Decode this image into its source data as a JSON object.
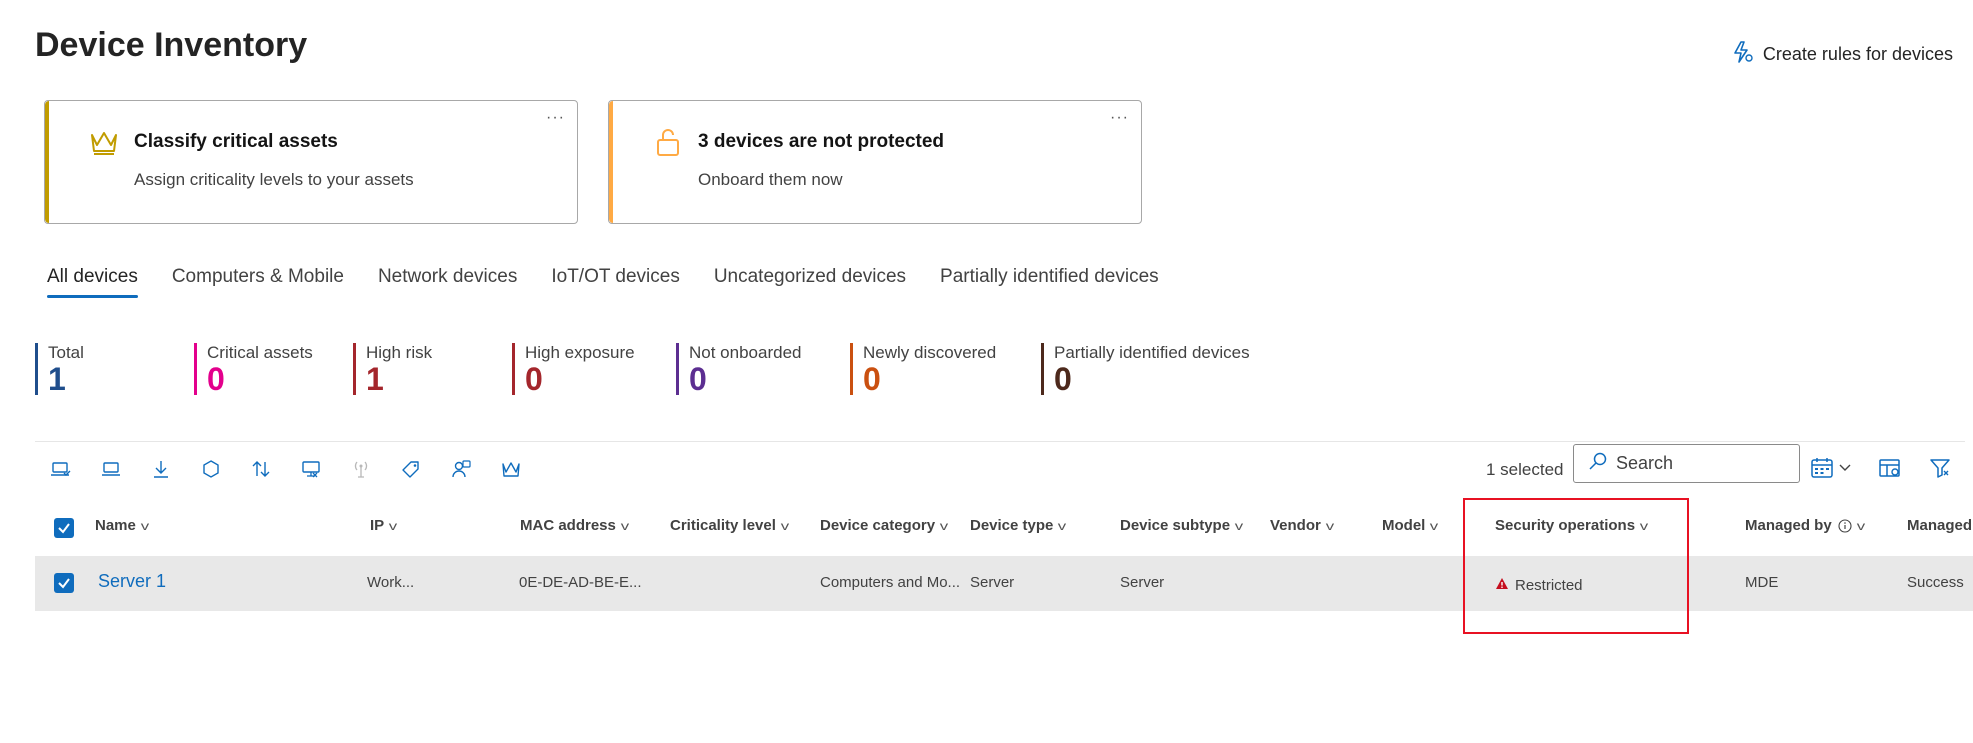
{
  "page": {
    "title": "Device Inventory"
  },
  "header": {
    "create_rules_label": "Create rules for devices"
  },
  "cards": [
    {
      "title": "Classify critical assets",
      "subtitle": "Assign criticality levels to your assets",
      "accent": "#c19c00",
      "icon": "crown-icon",
      "more": "···"
    },
    {
      "title": "3 devices are not protected",
      "subtitle": "Onboard them now",
      "accent": "#ffaa44",
      "icon": "unlocked-lock-icon",
      "more": "···"
    }
  ],
  "tabs": [
    {
      "label": "All devices",
      "active": true
    },
    {
      "label": "Computers & Mobile",
      "active": false
    },
    {
      "label": "Network devices",
      "active": false
    },
    {
      "label": "IoT/OT devices",
      "active": false
    },
    {
      "label": "Uncategorized devices",
      "active": false
    },
    {
      "label": "Partially identified devices",
      "active": false
    }
  ],
  "stats": [
    {
      "label": "Total",
      "value": "1",
      "color": "#1f4e8c"
    },
    {
      "label": "Critical assets",
      "value": "0",
      "color": "#e3008c"
    },
    {
      "label": "High risk",
      "value": "1",
      "color": "#a4262c"
    },
    {
      "label": "High exposure",
      "value": "0",
      "color": "#a4262c"
    },
    {
      "label": "Not onboarded",
      "value": "0",
      "color": "#5c2e91"
    },
    {
      "label": "Newly discovered",
      "value": "0",
      "color": "#ca5010"
    },
    {
      "label": "Partially identified devices",
      "value": "0",
      "color": "#4d291c"
    }
  ],
  "toolbar": {
    "icons": [
      "device-check-icon",
      "laptop-icon",
      "download-icon",
      "hexagon-icon",
      "sort-icon",
      "device-exclude-icon",
      "antenna-icon",
      "tag-icon",
      "user-assign-icon",
      "crown-icon"
    ],
    "selected_text": "1 selected",
    "search_placeholder": "Search",
    "right_icons": [
      "calendar-icon",
      "customize-columns-icon",
      "filter-icon"
    ]
  },
  "table": {
    "columns": [
      "Name",
      "IP",
      "MAC address",
      "Criticality level",
      "Device category",
      "Device type",
      "Device subtype",
      "Vendor",
      "Model",
      "Security operations",
      "Managed by",
      "Managed"
    ],
    "rows": [
      {
        "selected": true,
        "name": "Server 1",
        "ip": "Work...",
        "mac": "0E-DE-AD-BE-E...",
        "criticality": "",
        "category": "Computers and Mo...",
        "type": "Server",
        "subtype": "Server",
        "vendor": "",
        "model": "",
        "security_operations": "Restricted",
        "managed_by": "MDE",
        "managed": "Success"
      }
    ]
  },
  "colors": {
    "accent": "#0f6cbd",
    "highlight": "#e81123",
    "warning": "#c50f1f"
  }
}
